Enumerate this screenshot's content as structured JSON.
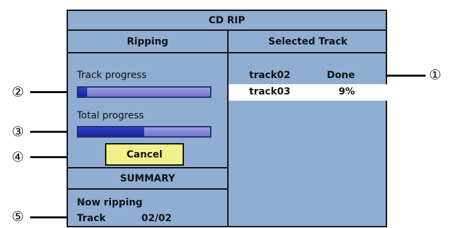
{
  "window": {
    "title": "CD RIP"
  },
  "ripping": {
    "header": "Ripping",
    "track_progress_label": "Track  progress",
    "track_progress_value": 0.07,
    "total_progress_label": "Total  progress",
    "total_progress_value": 0.5,
    "cancel_label": "Cancel"
  },
  "summary": {
    "header": "SUMMARY",
    "now_ripping_label": "Now ripping",
    "track_label": "Track",
    "track_value": "02/02"
  },
  "selected_track": {
    "header": "Selected  Track",
    "tracks": [
      {
        "name": "track02",
        "status": "Done"
      },
      {
        "name": "track03",
        "status": "9%"
      }
    ]
  },
  "callouts": [
    "1",
    "2",
    "3",
    "4",
    "5"
  ]
}
